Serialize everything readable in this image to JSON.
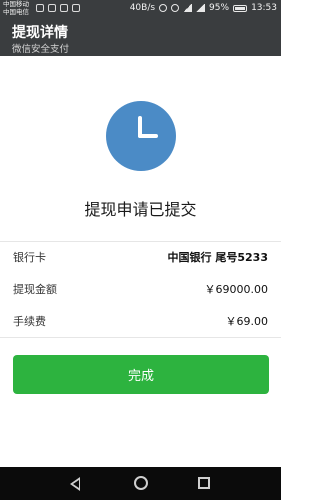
{
  "status_bar": {
    "carrier_1": "中国移动",
    "carrier_2": "中国电信",
    "net_speed": "40B/s",
    "net_badge_1": "2G",
    "net_badge_2": "4G",
    "battery": "95%",
    "time": "13:53"
  },
  "header": {
    "title": "提现详情",
    "subtitle": "微信安全支付"
  },
  "status": {
    "icon": "clock-icon",
    "accent": "#4b8bc6",
    "text": "提现申请已提交"
  },
  "details": {
    "bank_label": "银行卡",
    "bank_value": "中国银行 尾号5233",
    "amount_label": "提现金额",
    "amount_value": "￥69000.00",
    "fee_label": "手续费",
    "fee_value": "￥69.00"
  },
  "button": {
    "done_label": "完成",
    "color": "#2db33f"
  },
  "nav": {
    "back_icon": "back-icon",
    "home_icon": "home-icon",
    "recent_icon": "recent-apps-icon"
  }
}
